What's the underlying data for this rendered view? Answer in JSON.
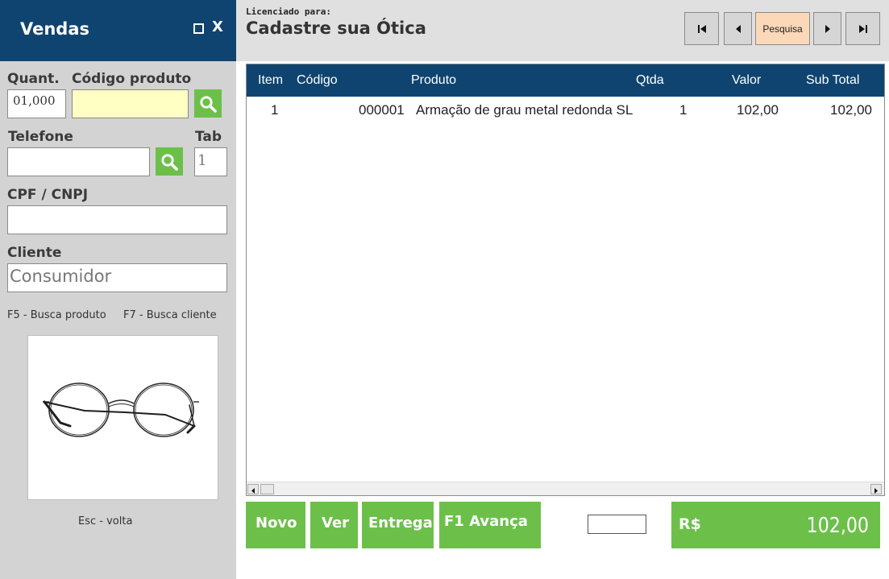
{
  "window": {
    "title": "Vendas",
    "maximize_icon": "square-icon",
    "close_label": "X"
  },
  "license": {
    "label": "Licenciado para:",
    "name": "Cadastre sua Ótica"
  },
  "nav": {
    "first_icon": "first-page-icon",
    "prev_icon": "prev-icon",
    "search_label": "Pesquisa",
    "next_icon": "next-icon",
    "last_icon": "last-page-icon"
  },
  "form": {
    "quant_label": "Quant.",
    "quant_value": "01,000",
    "codigo_label": "Código produto",
    "codigo_value": "",
    "telefone_label": "Telefone",
    "telefone_value": "",
    "tab_label": "Tab",
    "tab_value": "1",
    "cpf_label": "CPF / CNPJ",
    "cpf_value": "",
    "cliente_label": "Cliente",
    "cliente_value": "Consumidor",
    "search_icon": "search-icon"
  },
  "hints": {
    "busca_produto": "F5 - Busca produto",
    "busca_cliente": "F7 - Busca cliente",
    "esc": "Esc - volta"
  },
  "product_image": "glasses-image",
  "table": {
    "columns": [
      "Item",
      "Código",
      "Produto",
      "Qtda",
      "Valor",
      "Sub Total"
    ],
    "rows": [
      {
        "item": "1",
        "codigo": "000001",
        "produto": "Armação de grau metal redonda SL",
        "qtda": "1",
        "valor": "102,00",
        "subtotal": "102,00"
      }
    ]
  },
  "buttons": {
    "novo": "Novo",
    "ver": "Ver",
    "entrega": "Entrega",
    "avanca": "F1 Avança"
  },
  "total": {
    "currency": "R$",
    "value": "102,00"
  },
  "colors": {
    "header_blue": "#0f4470",
    "green": "#6cc04a",
    "panel_gray": "#d3d3d3",
    "code_field_yellow": "#ffffc4",
    "search_button_peach": "#fbd8b8"
  }
}
